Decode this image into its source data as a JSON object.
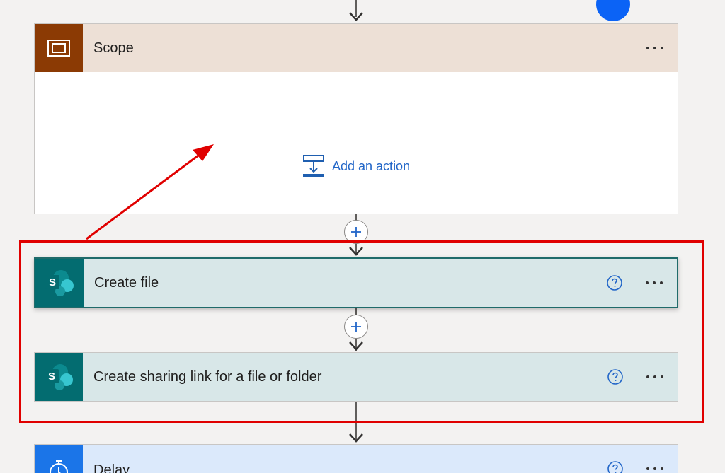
{
  "flow": {
    "scope": {
      "title": "Scope",
      "icon": "scope-icon",
      "add_action_label": "Add an action",
      "more": "more-options-icon"
    },
    "create_file": {
      "title": "Create file",
      "icon": "sharepoint-icon",
      "icon_letter": "S",
      "help": "help-icon",
      "more": "more-options-icon"
    },
    "share_link": {
      "title": "Create sharing link for a file or folder",
      "icon": "sharepoint-icon",
      "icon_letter": "S",
      "help": "help-icon",
      "more": "more-options-icon"
    },
    "delay": {
      "title": "Delay",
      "icon": "timer-icon",
      "help": "help-icon",
      "more": "more-options-icon"
    }
  },
  "colors": {
    "scope_tile": "#8b3a04",
    "scope_header": "#ede0d6",
    "sharepoint_tile": "#036c70",
    "sharepoint_card": "#d8e7e8",
    "delay_tile": "#1b75e8",
    "delay_card": "#dbe9fb",
    "link_blue": "#2266c8",
    "annotation_red": "#e00000"
  }
}
